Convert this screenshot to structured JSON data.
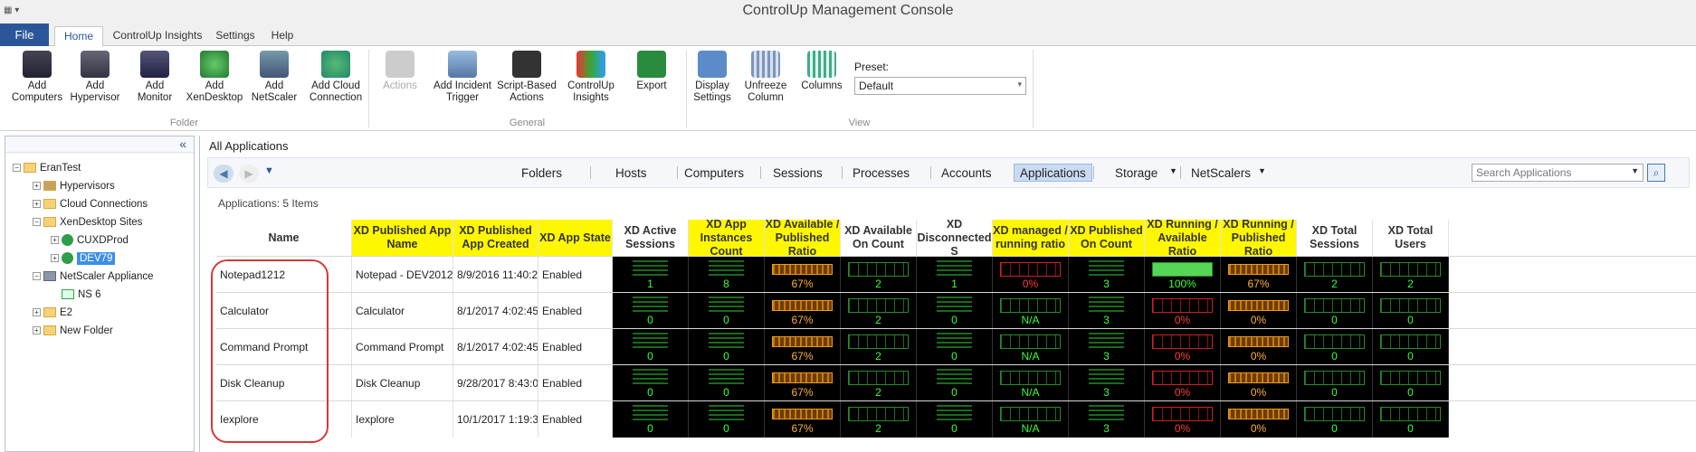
{
  "window": {
    "title": "ControlUp Management Console"
  },
  "ribbon_tabs": [
    "File",
    "Home",
    "ControlUp Insights",
    "Settings",
    "Help"
  ],
  "ribbon": {
    "buttons": [
      {
        "label": "Add\nComputers",
        "icon": "computers-add-icon"
      },
      {
        "label": "Add\nHypervisor",
        "icon": "hypervisor-add-icon"
      },
      {
        "label": "Add\nMonitor",
        "icon": "monitor-add-icon"
      },
      {
        "label": "Add\nXenDesktop",
        "icon": "xendesktop-add-icon"
      },
      {
        "label": "Add\nNetScaler",
        "icon": "netscaler-add-icon"
      },
      {
        "label": "Add Cloud\nConnection",
        "icon": "cloud-add-icon"
      },
      {
        "label": "Actions",
        "icon": "actions-icon"
      },
      {
        "label": "Add Incident\nTrigger",
        "icon": "incident-trigger-icon"
      },
      {
        "label": "Script-Based\nActions",
        "icon": "script-icon"
      },
      {
        "label": "ControlUp\nInsights",
        "icon": "insights-icon"
      },
      {
        "label": "Export",
        "icon": "excel-export-icon"
      },
      {
        "label": "Display\nSettings",
        "icon": "display-settings-icon"
      },
      {
        "label": "Unfreeze\nColumn",
        "icon": "unfreeze-column-icon"
      },
      {
        "label": "Columns",
        "icon": "columns-icon"
      }
    ],
    "groups": [
      "Folder",
      "General",
      "View"
    ],
    "preset_label": "Preset:",
    "preset_value": "Default"
  },
  "tree": [
    {
      "label": "EranTest",
      "type": "folder"
    },
    {
      "label": "Hypervisors",
      "type": "hypervisor"
    },
    {
      "label": "Cloud Connections",
      "type": "folder"
    },
    {
      "label": "XenDesktop Sites",
      "type": "folder"
    },
    {
      "label": "CUXDProd",
      "type": "site"
    },
    {
      "label": "DEV79",
      "type": "site-selected"
    },
    {
      "label": "NetScaler Appliance",
      "type": "netscaler"
    },
    {
      "label": "NS 6",
      "type": "ns"
    },
    {
      "label": "E2",
      "type": "folder"
    },
    {
      "label": "New Folder",
      "type": "folder"
    }
  ],
  "main": {
    "title": "All Applications",
    "nav_tabs": [
      "Folders",
      "Hosts",
      "Computers",
      "Sessions",
      "Processes",
      "Accounts",
      "Applications",
      "Storage",
      "NetScalers"
    ],
    "active_tab": "Applications",
    "search_placeholder": "Search Applications",
    "count_label": "Applications: 5 Items"
  },
  "columns": [
    "Name",
    "XD Published App Name",
    "XD Published App Created",
    "XD App State",
    "XD Active Sessions",
    "XD App Instances Count",
    "XD Available / Published Ratio",
    "XD Available On Count",
    "XD Disconnected S",
    "XD managed / running ratio",
    "XD Published On Count",
    "XD Running / Available Ratio",
    "XD Running / Published Ratio",
    "XD Total Sessions",
    "XD Total Users"
  ],
  "rows": [
    {
      "name": "Notepad1212",
      "pub_name": "Notepad - DEV2012R2...",
      "created": "8/9/2016 11:40:2...",
      "state": "Enabled",
      "active": "1",
      "instances": "8",
      "avail_pub": "67%",
      "avail_on": "2",
      "disc": "1",
      "managed_running": "0%",
      "pub_on": "3",
      "run_avail": "100%",
      "run_pub": "67%",
      "total_sessions": "2",
      "total_users": "2"
    },
    {
      "name": "Calculator",
      "pub_name": "Calculator",
      "created": "8/1/2017 4:02:45...",
      "state": "Enabled",
      "active": "0",
      "instances": "0",
      "avail_pub": "67%",
      "avail_on": "2",
      "disc": "0",
      "managed_running": "N/A",
      "pub_on": "3",
      "run_avail": "0%",
      "run_pub": "0%",
      "total_sessions": "0",
      "total_users": "0"
    },
    {
      "name": "Command Prompt",
      "pub_name": "Command Prompt",
      "created": "8/1/2017 4:02:45...",
      "state": "Enabled",
      "active": "0",
      "instances": "0",
      "avail_pub": "67%",
      "avail_on": "2",
      "disc": "0",
      "managed_running": "N/A",
      "pub_on": "3",
      "run_avail": "0%",
      "run_pub": "0%",
      "total_sessions": "0",
      "total_users": "0"
    },
    {
      "name": "Disk Cleanup",
      "pub_name": "Disk Cleanup",
      "created": "9/28/2017 8:43:0...",
      "state": "Enabled",
      "active": "0",
      "instances": "0",
      "avail_pub": "67%",
      "avail_on": "2",
      "disc": "0",
      "managed_running": "N/A",
      "pub_on": "3",
      "run_avail": "0%",
      "run_pub": "0%",
      "total_sessions": "0",
      "total_users": "0"
    },
    {
      "name": "Iexplore",
      "pub_name": "Iexplore",
      "created": "10/1/2017 1:19:3...",
      "state": "Enabled",
      "active": "0",
      "instances": "0",
      "avail_pub": "67%",
      "avail_on": "2",
      "disc": "0",
      "managed_running": "N/A",
      "pub_on": "3",
      "run_avail": "0%",
      "run_pub": "0%",
      "total_sessions": "0",
      "total_users": "0"
    }
  ],
  "colors": {
    "accent": "#2b579a",
    "highlight_header": "#fff700",
    "callout": "#d33a3a"
  }
}
